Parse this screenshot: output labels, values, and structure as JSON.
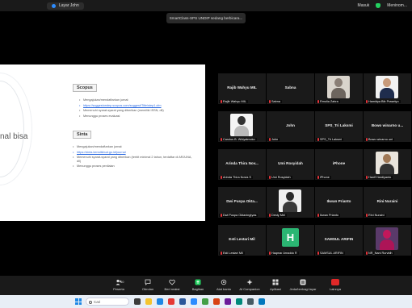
{
  "topbar": {
    "share_label": "Layar John",
    "right_labels": [
      "Masuk",
      "Meninom..."
    ]
  },
  "toast": "SmartClass-SPS UNDIP sedang berbicara...",
  "slide": {
    "big_text": "nal bisa",
    "scopus": {
      "title": "Scopus",
      "items": [
        {
          "text": "Mengajukan/mendaftarkan jurnal:"
        },
        {
          "text": "https://suggestorstep.scopus.com/suggest/Title/step1.cfm",
          "link": true
        },
        {
          "text": "Memenuhi syarat-syarat yang diberikan (memiliki ISSN, dll)"
        },
        {
          "text": "Menunggu proses evaluasi"
        }
      ]
    },
    "sinta": {
      "title": "Sinta",
      "items": [
        {
          "text": "Mengajukan/mendaftarkan jurnal:"
        },
        {
          "text": "https://sinta.kemdikbud.go.id/journal",
          "link": true
        },
        {
          "text": "Memenuhi syarat-syarat yang diberikan (terbit minimal 2 tahun, terdaftar di ARJUNA, dll)"
        },
        {
          "text": "Menunggu proses penilaian"
        }
      ]
    }
  },
  "participants": [
    {
      "center": "Rajib Wahyu MIL",
      "label": "Rajib Wahyu MIL"
    },
    {
      "center": "Sabna",
      "label": "Sabna"
    },
    {
      "center": "",
      "label": "Rmulia Zahra",
      "photo": "hijab-grey"
    },
    {
      "center": "",
      "label": "Hamidya Bib Prasetyo",
      "photo": "suit"
    },
    {
      "center": "",
      "label": "Carolus B. Widyatmoko",
      "photo": "plain"
    },
    {
      "center": "John",
      "label": "John"
    },
    {
      "center": "SPS_Tri Laksmi",
      "label": "SPS_Tri Laksmi"
    },
    {
      "center": "Bowo winarno u...",
      "label": "Bowo winarno uni"
    },
    {
      "center": "Arinda Thira Nov...",
      "label": "Arinda Thira Novia S"
    },
    {
      "center": "Umi Rosyidah",
      "label": "Umi Rosyidah"
    },
    {
      "center": "iPhone",
      "label": "iPhone"
    },
    {
      "center": "",
      "label": "Hanif Hardiyanto",
      "photo": "man"
    },
    {
      "center": "Dwi Puspa Okta...",
      "label": "Dwi Puspa Oktaningtyas"
    },
    {
      "center": "",
      "label": "Desty Mei",
      "photo": "hijab-dark"
    },
    {
      "center": "Ikwan Prianto",
      "label": "Ikwan Prianto"
    },
    {
      "center": "Rini Nuraini",
      "label": "Rini Nuraini"
    },
    {
      "center": "Esti Lestari Mil",
      "label": "Esti Lestari Mil"
    },
    {
      "center": "",
      "label": "Haqmar Arraddo R",
      "initial": "H"
    },
    {
      "center": "SAMSUL ARIFIN",
      "label": "SAMSUL ARIFIN"
    },
    {
      "center": "",
      "label": "NR_Nani Rurvidh",
      "photo": "hijab-pink"
    }
  ],
  "toolbar": {
    "items": [
      "Peserta",
      "Obrolan",
      "Beri reaksi",
      "Bagikan",
      "Alat bantu",
      "AI Companion",
      "Aplikasi",
      "Jeda/berbagi layar"
    ],
    "participant_count": "40",
    "leave": "Lainnya"
  },
  "taskbar": {
    "search_placeholder": "Cari",
    "clock_time": "",
    "clock_date": ""
  },
  "colors": {
    "accent": "#2d8cff",
    "hbox": "#2bb673",
    "mic_muted": "#e5353b",
    "leave": "#e02828"
  }
}
